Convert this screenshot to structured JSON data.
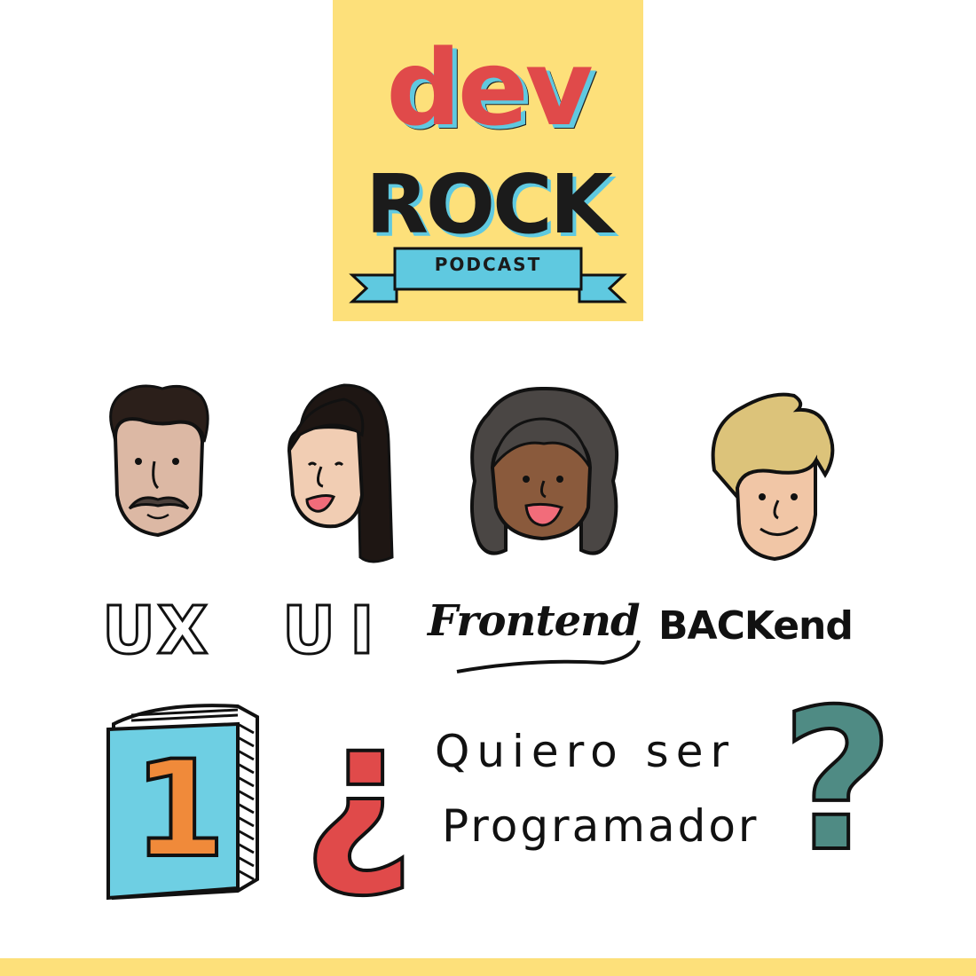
{
  "colors": {
    "logo_background": "#fde07a",
    "dev_red": "#e04a4a",
    "accent_blue": "#5fc9e0",
    "book_orange": "#f08a3a",
    "question_teal": "#4f8b84",
    "bottom_strip": "#fde07a"
  },
  "logo": {
    "line1": "dev",
    "line2": "ROCK",
    "ribbon": "PODCAST"
  },
  "faces": [
    {
      "name": "man-with-mustache-face-icon"
    },
    {
      "name": "woman-long-black-hair-face-icon"
    },
    {
      "name": "woman-curly-hair-face-icon"
    },
    {
      "name": "blonde-person-face-icon"
    }
  ],
  "roles": {
    "ux": "UX",
    "ui": "UI",
    "frontend": "Frontend",
    "backend": "BACKend"
  },
  "book": {
    "number": "1"
  },
  "question": {
    "open_mark": "¿",
    "line1": "Quiero ser",
    "line2": "Programador",
    "close_mark": "?"
  }
}
